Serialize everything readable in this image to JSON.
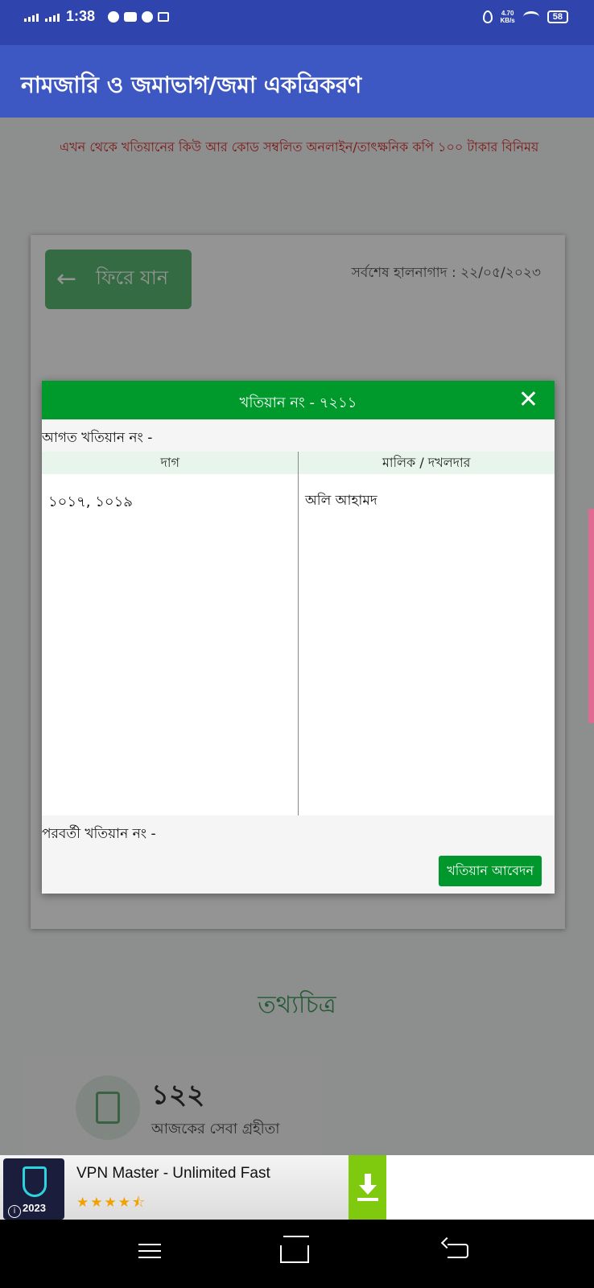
{
  "status_bar": {
    "time": "1:38",
    "speed_value": "4.70",
    "speed_unit": "KB/s",
    "battery": "58"
  },
  "app_bar": {
    "title": "নামজারি ও জমাভাগ/জমা একত্রিকরণ"
  },
  "page": {
    "marquee": "এখন থেকে খতিয়ানের কিউ আর কোড সম্বলিত অনলাইন/তাৎক্ষনিক কপি ১০০ টাকার বিনিময়",
    "back_button_label": "ফিরে যান",
    "last_updated": "সর্বশেষ হালনাগাদ : ২২/০৫/২০২৩",
    "info_title": "তথ্যচিত্র",
    "stat_number": "১২২",
    "stat_label": "আজকের সেবা গ্রহীতা"
  },
  "modal": {
    "title": "খতিয়ান নং - ৭২১১",
    "previous_khatian": "আগত খতিয়ান নং -",
    "columns": [
      "দাগ",
      "মালিক / দখলদার"
    ],
    "rows": [
      {
        "dag": "১০১৭, ১০১৯",
        "owner": "অলি আহামদ"
      }
    ],
    "next_khatian": "পরবর্তী খতিয়ান নং -",
    "apply_button": "খতিয়ান আবেদন"
  },
  "ad": {
    "app_name": "VPN Master - Unlimited Fast",
    "year": "2023",
    "rating": 4.5
  },
  "colors": {
    "status_bar": "#2f45ad",
    "app_bar": "#3d57c3",
    "modal_header": "#009a2c",
    "marquee_text": "#d82b2b",
    "back_button": "#5cb874",
    "ad_download": "#7fc90f"
  },
  "icons": [
    "back-arrow-icon",
    "close-icon",
    "scroll-document-icon",
    "shield-key-icon",
    "download-icon",
    "menu-icon",
    "home-icon",
    "back-nav-icon"
  ]
}
